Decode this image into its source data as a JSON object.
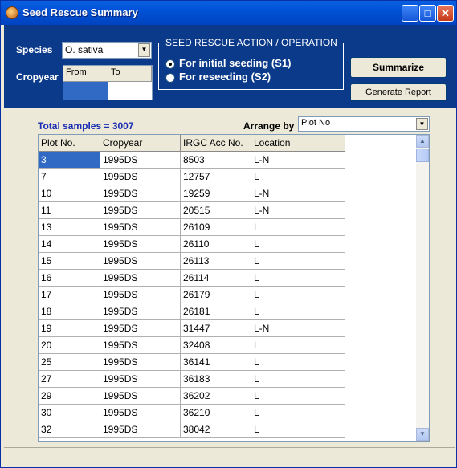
{
  "window": {
    "title": "Seed Rescue Summary",
    "minimize": "_",
    "maximize": "□",
    "close": "✕"
  },
  "filters": {
    "species_label": "Species",
    "species_value": "O. sativa",
    "cropyear_label": "Cropyear",
    "cropyear_from": "From",
    "cropyear_to": "To"
  },
  "action": {
    "group_title": "SEED RESCUE ACTION / OPERATION",
    "options": [
      {
        "label": "For initial seeding (S1)",
        "selected": true
      },
      {
        "label": "For reseeding (S2)",
        "selected": false
      }
    ]
  },
  "buttons": {
    "summarize": "Summarize",
    "generate_report": "Generate Report"
  },
  "summary": {
    "total": "Total samples = 3007",
    "arrange_label": "Arrange by",
    "arrange_value": "Plot No"
  },
  "table": {
    "columns": [
      "Plot No.",
      "Cropyear",
      "IRGC Acc No.",
      "Location"
    ],
    "rows": [
      [
        "3",
        "1995DS",
        "8503",
        "L-N"
      ],
      [
        "7",
        "1995DS",
        "12757",
        "L"
      ],
      [
        "10",
        "1995DS",
        "19259",
        "L-N"
      ],
      [
        "11",
        "1995DS",
        "20515",
        "L-N"
      ],
      [
        "13",
        "1995DS",
        "26109",
        "L"
      ],
      [
        "14",
        "1995DS",
        "26110",
        "L"
      ],
      [
        "15",
        "1995DS",
        "26113",
        "L"
      ],
      [
        "16",
        "1995DS",
        "26114",
        "L"
      ],
      [
        "17",
        "1995DS",
        "26179",
        "L"
      ],
      [
        "18",
        "1995DS",
        "26181",
        "L"
      ],
      [
        "19",
        "1995DS",
        "31447",
        "L-N"
      ],
      [
        "20",
        "1995DS",
        "32408",
        "L"
      ],
      [
        "25",
        "1995DS",
        "36141",
        "L"
      ],
      [
        "27",
        "1995DS",
        "36183",
        "L"
      ],
      [
        "29",
        "1995DS",
        "36202",
        "L"
      ],
      [
        "30",
        "1995DS",
        "36210",
        "L"
      ],
      [
        "32",
        "1995DS",
        "38042",
        "L"
      ]
    ]
  },
  "colors": {
    "title_blue": "#0052d6",
    "panel_blue": "#0b3a8a",
    "selection": "#316ac5",
    "total_text": "#1c2eb3"
  }
}
